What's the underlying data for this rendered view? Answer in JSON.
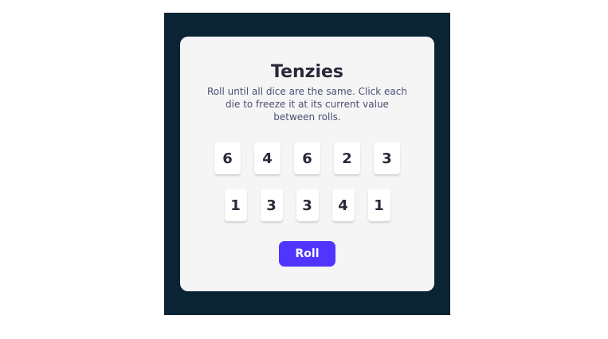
{
  "game": {
    "title": "Tenzies",
    "instructions": "Roll until all dice are the same. Click each die to freeze it at its current value between rolls.",
    "dice_row_1": [
      "6",
      "4",
      "6",
      "2",
      "3"
    ],
    "dice_row_2": [
      "1",
      "3",
      "3",
      "4",
      "1"
    ],
    "roll_label": "Roll"
  },
  "colors": {
    "frame_background": "#0b2434",
    "card_background": "#f5f5f5",
    "die_background": "#ffffff",
    "text_dark": "#2b283a",
    "button_accent": "#5035ff"
  }
}
